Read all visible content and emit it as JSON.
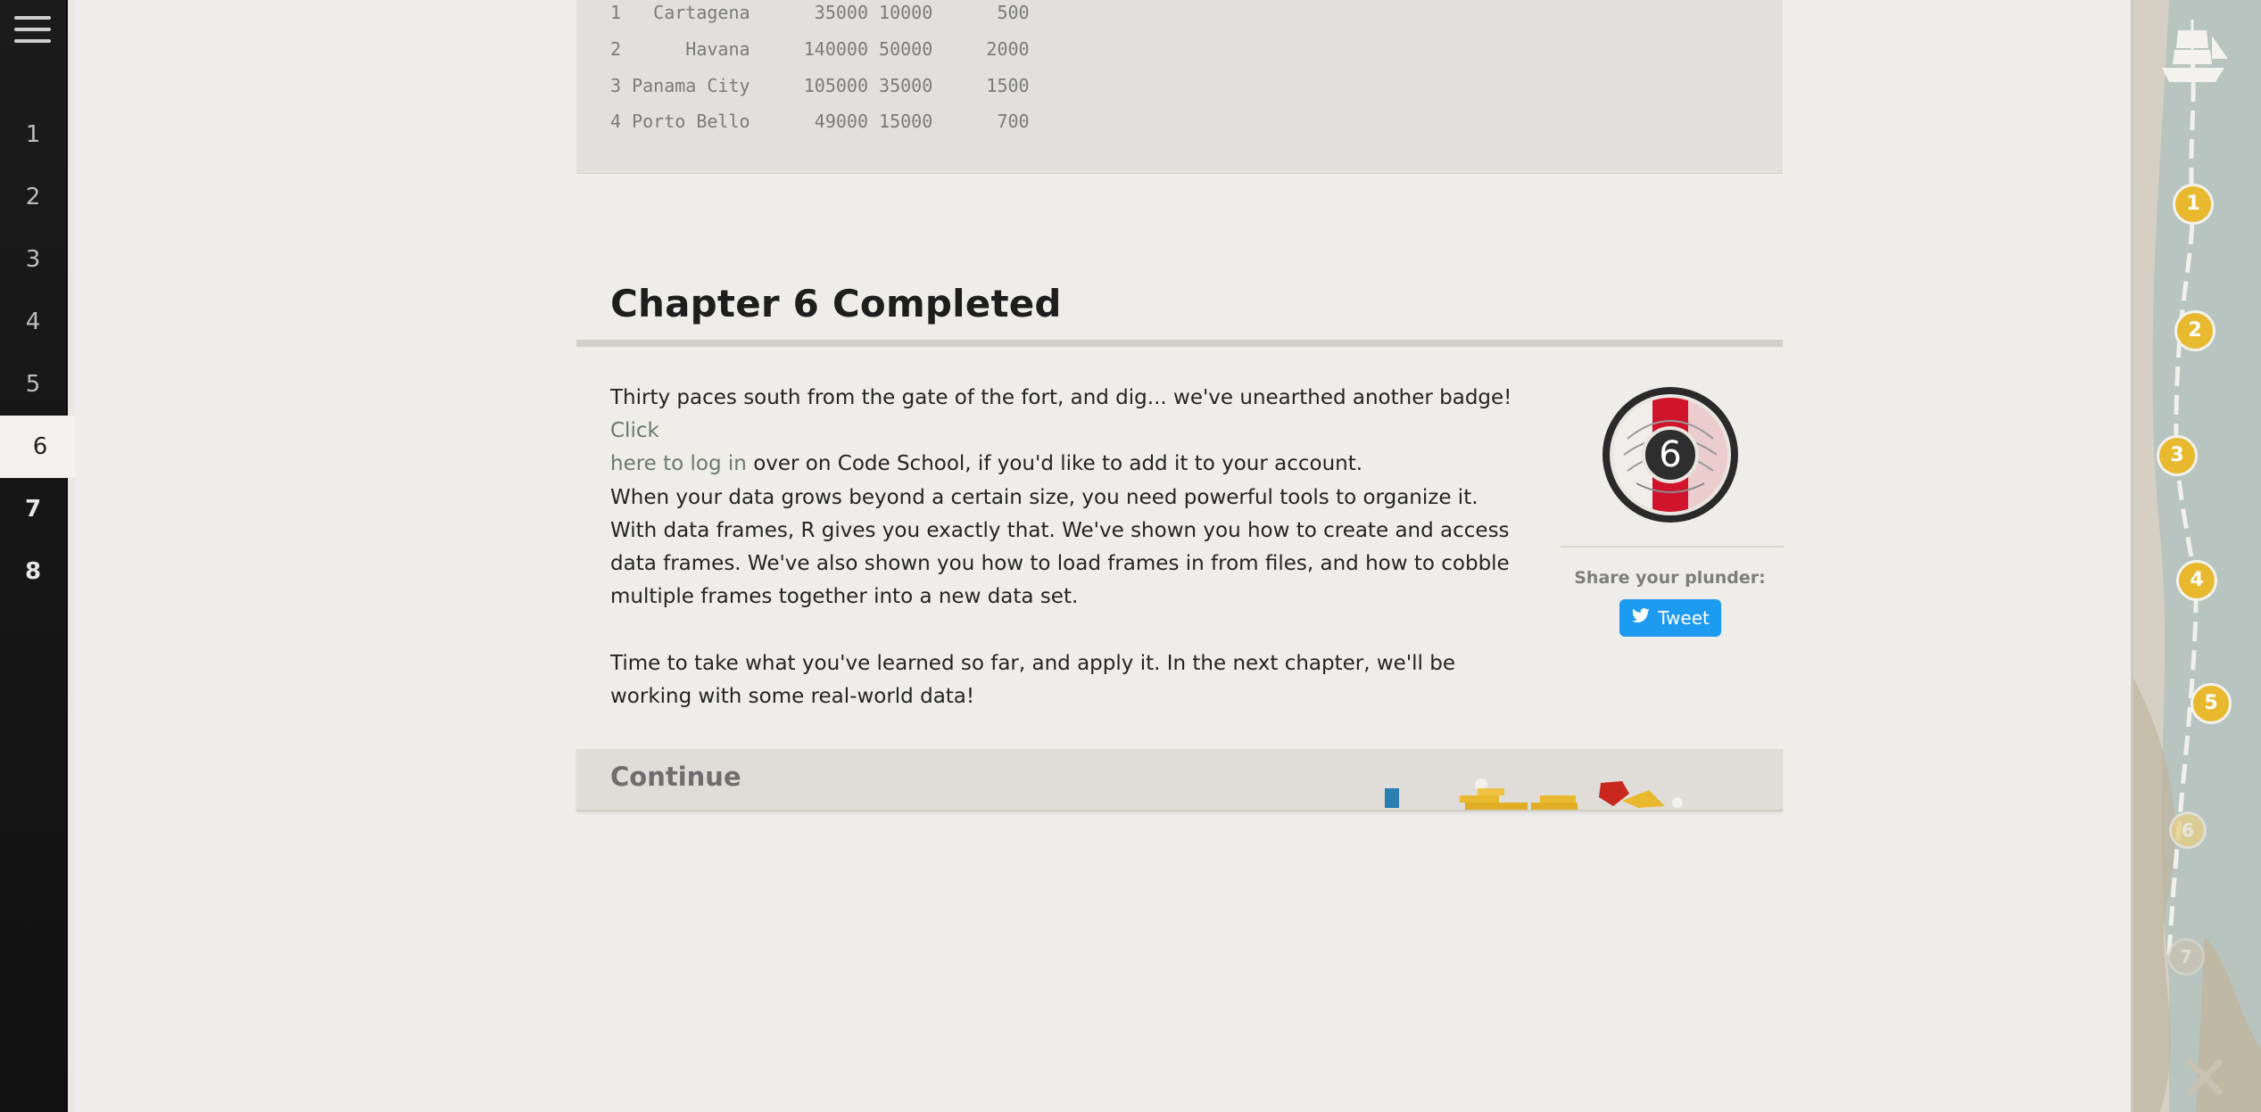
{
  "nav": {
    "menu_icon": "hamburger-icon",
    "chapters": [
      {
        "label": "1",
        "state": "done"
      },
      {
        "label": "2",
        "state": "done"
      },
      {
        "label": "3",
        "state": "done"
      },
      {
        "label": "4",
        "state": "done"
      },
      {
        "label": "5",
        "state": "done"
      },
      {
        "label": "6",
        "state": "active"
      },
      {
        "label": "7",
        "state": "unlocked"
      },
      {
        "label": "8",
        "state": "unlocked"
      }
    ]
  },
  "code_output": {
    "lines": [
      "1   Cartagena      35000 10000      500",
      "2      Havana     140000 50000     2000",
      "3 Panama City     105000 35000     1500",
      "4 Porto Bello      49000 15000      700"
    ]
  },
  "completion": {
    "title": "Chapter 6 Completed",
    "p1_text_a": "Thirty paces south from the gate of the fort, and dig... we've unearthed another badge! ",
    "p1_link_a": "Click",
    "p1_link_b": "here to log in",
    "p1_text_b": " over on Code School, if you'd like to add it to your account.",
    "p2": "When your data grows beyond a certain size, you need powerful tools to organize it. With data frames, R gives you exactly that. We've shown you how to create and access data frames. We've also shown you how to load frames in from files, and how to cobble multiple frames together into a new data set.",
    "p3": "Time to take what you've learned so far, and apply it. In the next chapter, we'll be working with some real-world data!",
    "badge_number": "6",
    "share_label": "Share your plunder:",
    "tweet_label": "Tweet",
    "continue_label": "Continue"
  },
  "map": {
    "markers": [
      "1",
      "2",
      "3",
      "4",
      "5",
      "6",
      "7"
    ],
    "ship_icon": "ship-icon",
    "end_icon": "x-marks-the-spot-icon"
  },
  "colors": {
    "accent_link": "#6b7a6a",
    "tweet_blue": "#1d9bf0",
    "badge_red": "#d0142b",
    "marker_gold": "#e8b92f"
  }
}
